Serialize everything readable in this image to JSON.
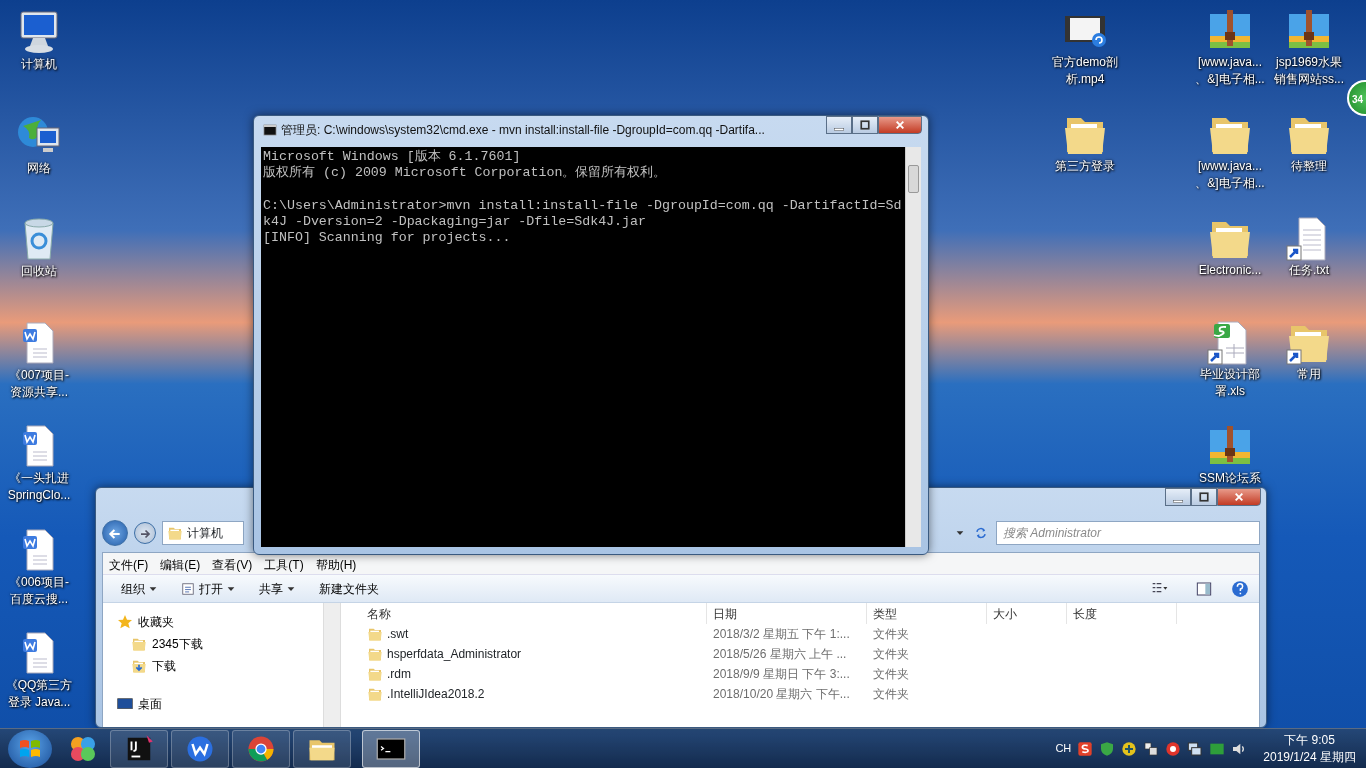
{
  "desktop": {
    "left_icons": [
      {
        "kind": "computer",
        "lines": [
          "计算机"
        ],
        "shortcut": false
      },
      {
        "kind": "network",
        "lines": [
          "网络"
        ],
        "shortcut": false
      },
      {
        "kind": "recycle",
        "lines": [
          "回收站"
        ],
        "shortcut": false
      },
      {
        "kind": "doc",
        "lines": [
          "《007项目-",
          "资源共享..."
        ],
        "shortcut": false
      },
      {
        "kind": "doc",
        "lines": [
          "《一头扎进",
          "SpringClo..."
        ],
        "shortcut": false
      },
      {
        "kind": "doc",
        "lines": [
          "《006项目-",
          "百度云搜..."
        ],
        "shortcut": false
      },
      {
        "kind": "doc",
        "lines": [
          "《QQ第三方",
          "登录 Java..."
        ],
        "shortcut": false
      }
    ],
    "right_columns": [
      [
        {
          "kind": "video",
          "lines": [
            "官方demo剖",
            "析.mp4"
          ],
          "shortcut": false
        },
        {
          "kind": "folder",
          "lines": [
            "第三方登录"
          ],
          "shortcut": false
        }
      ],
      [
        {
          "kind": "zip",
          "lines": [
            "[www.java...",
            "、&]电子相..."
          ],
          "shortcut": false
        },
        {
          "kind": "folder",
          "lines": [
            "[www.java...",
            "、&]电子相..."
          ],
          "shortcut": false
        },
        {
          "kind": "folder",
          "lines": [
            "Electronic..."
          ],
          "shortcut": false
        },
        {
          "kind": "xls",
          "lines": [
            "毕业设计部",
            "署.xls"
          ],
          "shortcut": true
        },
        {
          "kind": "zip",
          "lines": [
            "SSM论坛系"
          ],
          "shortcut": false
        }
      ],
      [
        {
          "kind": "zip",
          "lines": [
            "jsp1969水果",
            "销售网站ss..."
          ],
          "shortcut": false
        },
        {
          "kind": "folder",
          "lines": [
            "待整理"
          ],
          "shortcut": false
        },
        {
          "kind": "txt",
          "lines": [
            "任务.txt"
          ],
          "shortcut": true
        },
        {
          "kind": "folder",
          "lines": [
            "常用"
          ],
          "shortcut": true
        }
      ]
    ],
    "floating_badge": "34"
  },
  "explorer": {
    "breadcrumb": "计算机",
    "search": {
      "placeholder": "搜索 Administrator"
    },
    "menu": [
      "文件(F)",
      "编辑(E)",
      "查看(V)",
      "工具(T)",
      "帮助(H)"
    ],
    "toolbar": [
      {
        "label": "组织",
        "dropdown": true,
        "icon": false
      },
      {
        "label": "打开",
        "dropdown": true,
        "icon": true
      },
      {
        "label": "共享",
        "dropdown": true,
        "icon": false
      },
      {
        "label": "新建文件夹",
        "dropdown": false,
        "icon": false
      }
    ],
    "sidebar": [
      {
        "label": "收藏夹",
        "kind": "star"
      },
      {
        "label": "2345下载",
        "kind": "folder"
      },
      {
        "label": "下载",
        "kind": "download"
      },
      {
        "label": "桌面",
        "kind": "desktop"
      }
    ],
    "columns": [
      "名称",
      "日期",
      "类型",
      "大小",
      "长度"
    ],
    "rows": [
      {
        "name": ".swt",
        "date": "2018/3/2 星期五 下午 1:...",
        "type": "文件夹"
      },
      {
        "name": "hsperfdata_Administrator",
        "date": "2018/5/26 星期六 上午 ...",
        "type": "文件夹"
      },
      {
        "name": ".rdm",
        "date": "2018/9/9 星期日 下午 3:...",
        "type": "文件夹"
      },
      {
        "name": ".IntelliJIdea2018.2",
        "date": "2018/10/20 星期六 下午...",
        "type": "文件夹"
      }
    ]
  },
  "console": {
    "title": "管理员: C:\\windows\\system32\\cmd.exe - mvn  install:install-file -DgroupId=com.qq -Dartifa...",
    "blocks": [
      [
        "Microsoft Windows [版本 6.1.7601]",
        "版权所有 (c) 2009 Microsoft Corporation。保留所有权利。"
      ],
      [
        "C:\\Users\\Administrator>mvn install:install-file -DgroupId=com.qq -DartifactId=Sd",
        "k4J -Dversion=2 -Dpackaging=jar -Dfile=Sdk4J.jar",
        "[INFO] Scanning for projects..."
      ]
    ]
  },
  "taskbar": {
    "apps": [
      {
        "kind": "ij",
        "active": false
      },
      {
        "kind": "wps",
        "active": false
      },
      {
        "kind": "chrome",
        "active": false
      },
      {
        "kind": "explorer",
        "active": false
      },
      {
        "kind": "cmd",
        "active": true
      }
    ],
    "language": "CH",
    "time": "下午 9:05",
    "date": "2019/1/24 星期四"
  }
}
